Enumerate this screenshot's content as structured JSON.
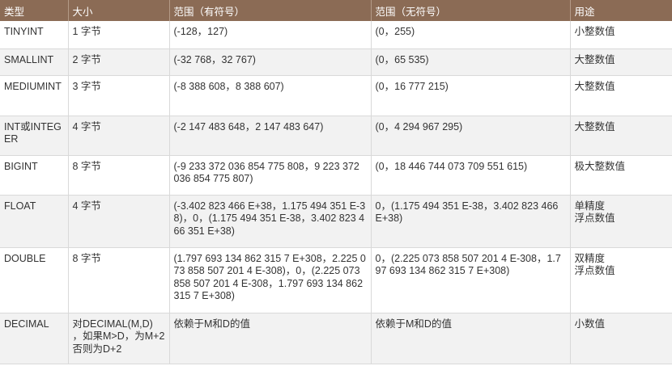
{
  "headers": [
    "类型",
    "大小",
    "范围（有符号）",
    "范围（无符号）",
    "用途"
  ],
  "rows": [
    [
      "TINYINT",
      "1 字节",
      "(-128，127)",
      "(0，255)",
      "小整数值"
    ],
    [
      "SMALLINT",
      "2 字节",
      "(-32 768，32 767)",
      "(0，65 535)",
      "大整数值"
    ],
    [
      "MEDIUMINT",
      "3 字节",
      "(-8 388 608，8 388 607)",
      "(0，16 777 215)",
      "大整数值"
    ],
    [
      "INT或INTEGER",
      "4 字节",
      "(-2 147 483 648，2 147 483 647)",
      "(0，4 294 967 295)",
      "大整数值"
    ],
    [
      "BIGINT",
      "8 字节",
      "(-9 233 372 036 854 775 808，9 223 372 036 854 775 807)",
      "(0，18 446 744 073 709 551 615)",
      "极大整数值"
    ],
    [
      "FLOAT",
      "4 字节",
      "(-3.402 823 466 E+38，1.175 494 351 E-38)，0，(1.175 494 351 E-38，3.402 823 466 351 E+38)",
      "0，(1.175 494 351 E-38，3.402 823 466 E+38)",
      "单精度\n浮点数值"
    ],
    [
      "DOUBLE",
      "8 字节",
      "(1.797 693 134 862 315 7 E+308，2.225 073 858 507 201 4 E-308)，0，(2.225 073 858 507 201 4 E-308，1.797 693 134 862 315 7 E+308)",
      "0，(2.225 073 858 507 201 4 E-308，1.797 693 134 862 315 7 E+308)",
      "双精度\n浮点数值"
    ],
    [
      "DECIMAL",
      "对DECIMAL(M,D) ，如果M>D，为M+2否则为D+2",
      "依赖于M和D的值",
      "依赖于M和D的值",
      "小数值"
    ]
  ]
}
